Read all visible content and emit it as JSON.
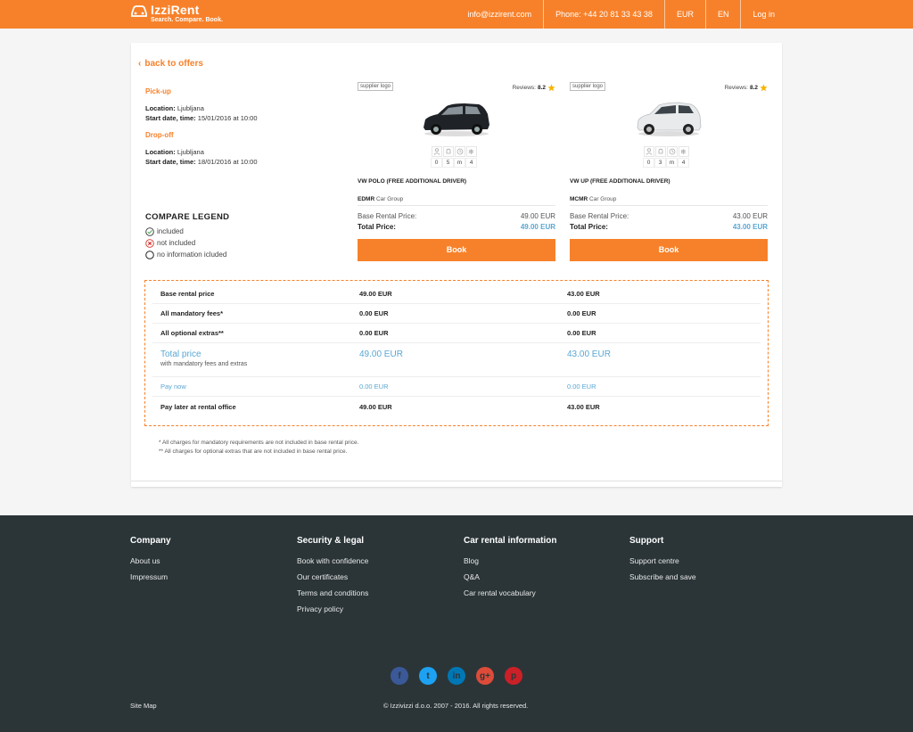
{
  "brand": {
    "name": "IzziRent",
    "tagline": "Search. Compare. Book."
  },
  "nav": {
    "email": "info@izzirent.com",
    "phone": "Phone: +44 20 81 33 43 38",
    "currency": "EUR",
    "language": "EN",
    "login": "Log in"
  },
  "back_link": "back to offers",
  "pickup": {
    "title": "Pick-up",
    "location_label": "Location:",
    "location": "Ljubljana",
    "date_label": "Start date, time:",
    "date": "15/01/2016 at 10:00"
  },
  "dropoff": {
    "title": "Drop-off",
    "location_label": "Location:",
    "location": "Ljubljana",
    "date_label": "Start date, time:",
    "date": "18/01/2016 at 10:00"
  },
  "legend": {
    "title": "COMPARE LEGEND",
    "included": "included",
    "not_included": "not included",
    "no_info": "no information icluded"
  },
  "offers": [
    {
      "supplier": "supplier logo",
      "reviews_label": "Reviews:",
      "rating": "8.2",
      "features": [
        "0",
        "5",
        "m",
        "4"
      ],
      "car_name": "VW POLO (FREE ADDITIONAL DRIVER)",
      "group_code": "EDMR",
      "group_label": "Car Group",
      "base_label": "Base Rental Price:",
      "base_price": "49.00 EUR",
      "total_label": "Total Price:",
      "total_price": "49.00 EUR",
      "book": "Book",
      "car_color": "#1f2327"
    },
    {
      "supplier": "supplier logo",
      "reviews_label": "Reviews:",
      "rating": "8.2",
      "features": [
        "0",
        "3",
        "m",
        "4"
      ],
      "car_name": "VW UP (FREE ADDITIONAL DRIVER)",
      "group_code": "MCMR",
      "group_label": "Car Group",
      "base_label": "Base Rental Price:",
      "base_price": "43.00 EUR",
      "total_label": "Total Price:",
      "total_price": "43.00 EUR",
      "book": "Book",
      "car_color": "#e8eaec"
    }
  ],
  "compare": {
    "rows": [
      {
        "label": "Base rental price",
        "v1": "49.00 EUR",
        "v2": "43.00 EUR"
      },
      {
        "label": "All mandatory fees*",
        "v1": "0.00 EUR",
        "v2": "0.00 EUR"
      },
      {
        "label": "All optional extras**",
        "v1": "0.00 EUR",
        "v2": "0.00 EUR"
      },
      {
        "label": "Total price",
        "sub": "with mandatory fees and extras",
        "v1": "49.00 EUR",
        "v2": "43.00 EUR"
      },
      {
        "label": "Pay now",
        "v1": "0.00 EUR",
        "v2": "0.00 EUR"
      },
      {
        "label": "Pay later at rental office",
        "v1": "49.00 EUR",
        "v2": "43.00 EUR"
      }
    ]
  },
  "notes": [
    "* All charges for mandatory requirements are not included in base rental price.",
    "** All charges for optional extras that are not included in base rental price."
  ],
  "footer": {
    "columns": [
      {
        "title": "Company",
        "links": [
          "About us",
          "Impressum"
        ]
      },
      {
        "title": "Security & legal",
        "links": [
          "Book with confidence",
          "Our certificates",
          "Terms and conditions",
          "Privacy policy"
        ]
      },
      {
        "title": "Car rental information",
        "links": [
          "Blog",
          "Q&A",
          "Car rental vocabulary"
        ]
      },
      {
        "title": "Support",
        "links": [
          "Support centre",
          "Subscribe and save"
        ]
      }
    ],
    "social": [
      "f",
      "t",
      "in",
      "g+",
      "p"
    ],
    "sitemap": "Site Map",
    "copyright": "© Izzivizzi d.o.o. 2007 - 2016. All rights reserved."
  },
  "colors": {
    "accent": "#f7812a",
    "price_blue": "#59a7d3",
    "footer_bg": "#2b3538"
  }
}
